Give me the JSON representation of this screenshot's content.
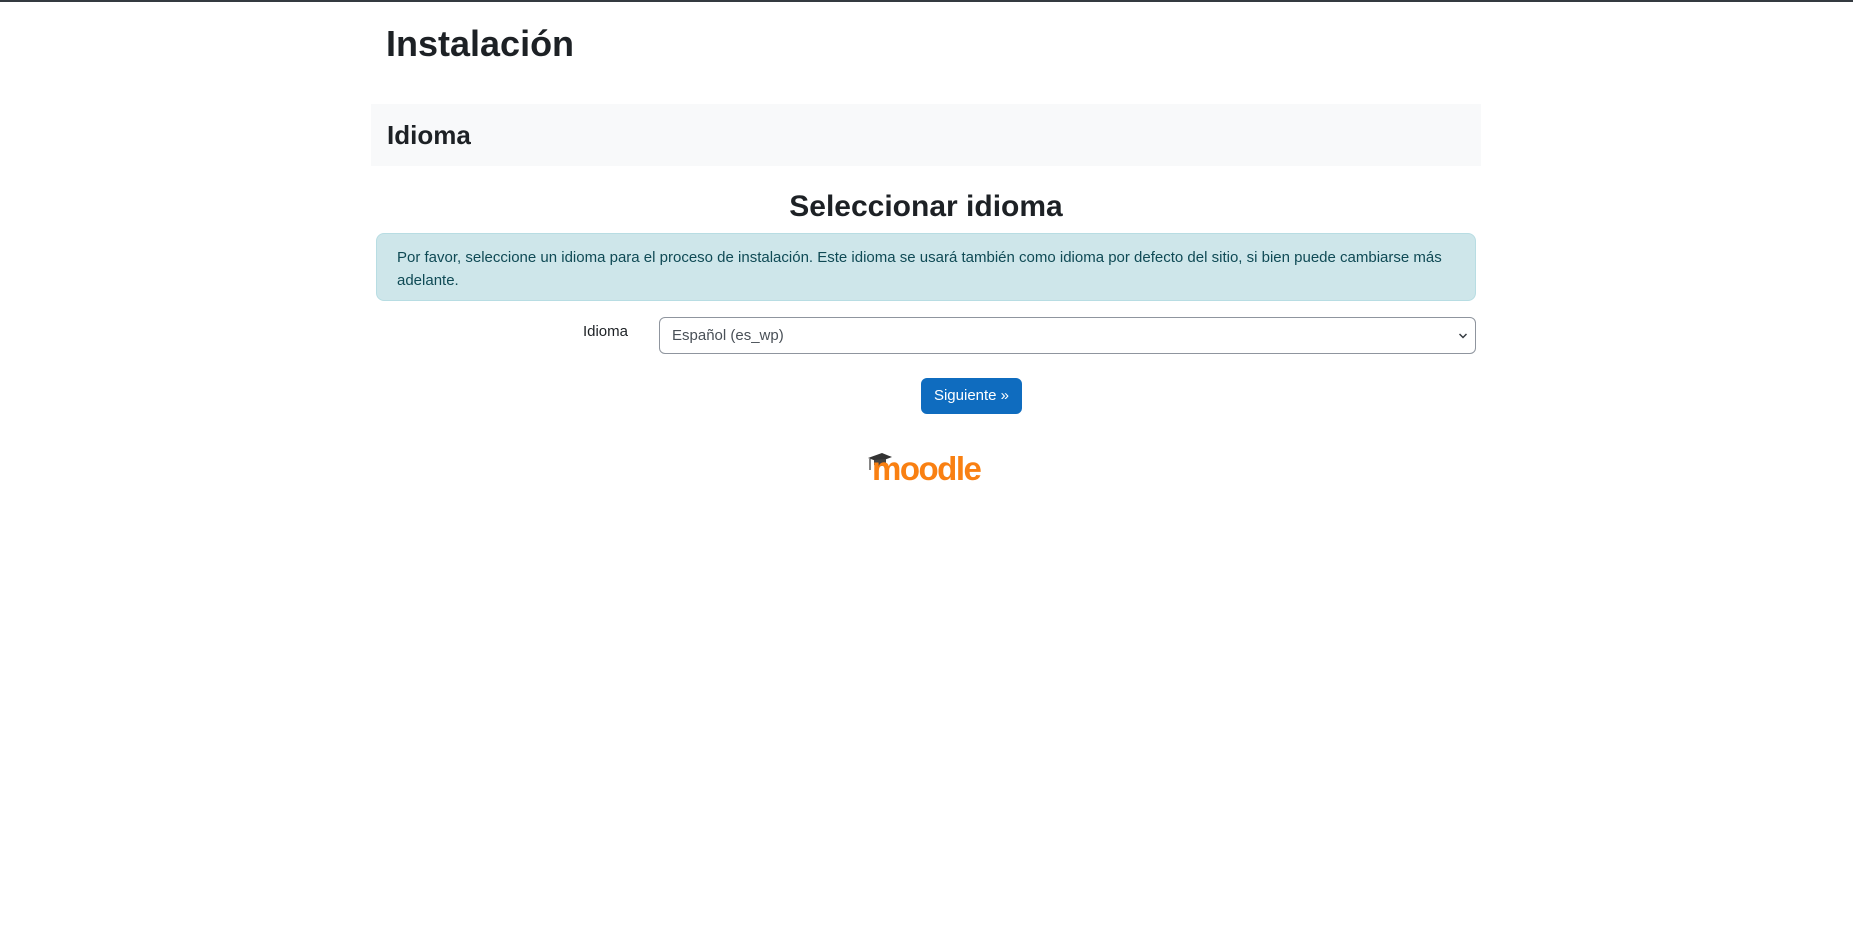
{
  "header": {
    "title": "Instalación"
  },
  "section": {
    "title": "Idioma"
  },
  "main": {
    "heading": "Seleccionar idioma",
    "info_text": "Por favor, seleccione un idioma para el proceso de instalación. Este idioma se usará también como idioma por defecto del sitio, si bien puede cambiarse más adelante.",
    "language_label": "Idioma",
    "language_selected": "Español (es_wp)",
    "next_button": "Siguiente »"
  },
  "footer": {
    "logo_text": "moodle"
  },
  "colors": {
    "primary": "#0f6cbf",
    "logo_orange": "#f98012",
    "info_bg": "#cee6ea",
    "section_bg": "#f8f9fa"
  },
  "icons": {
    "select_arrow": "chevron-down-icon",
    "logo_hat": "graduation-cap-icon"
  }
}
